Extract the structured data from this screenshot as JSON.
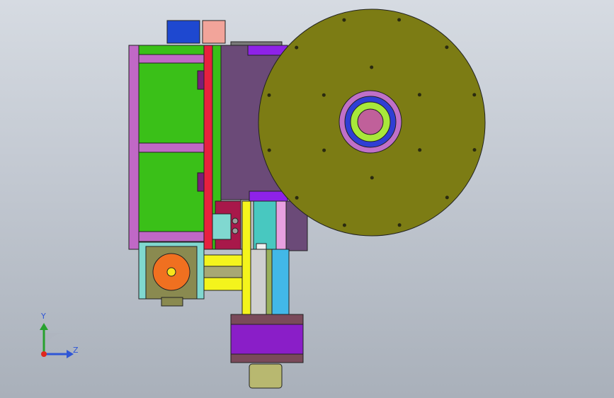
{
  "viewport": {
    "kind": "3D CAD assembly view (orthographic, top view)",
    "background_gradient": [
      "#d6dbe2",
      "#a9b0ba"
    ]
  },
  "triad": {
    "y_label": "Y",
    "z_label": "Z",
    "colors": {
      "y": "#27a12e",
      "z": "#2f56d6",
      "x": "#e0271e"
    }
  },
  "parts": {
    "top_blocks": {
      "blue": "#1e48d0",
      "pink": "#f2a49a"
    },
    "frame_purple": "#c068c6",
    "green_panel": "#3ac018",
    "red_plate": "#e8213e",
    "mauve_housing": "#6b4a78",
    "violet_bracket": "#8e22e8",
    "disc": {
      "fill": "#7c7c14",
      "hub_pink": "#c070c8",
      "hub_blue": "#2f3ed4",
      "hub_green": "#a8e83a",
      "hub_center": "#c0609a"
    },
    "motor": {
      "plate": "#8a8a50",
      "rotor": "#f07020",
      "rotor_center": "#f8e41c",
      "mount": "#80d8d0"
    },
    "yellow_link": "#f4f41c",
    "rail": {
      "cyan": "#48c8c0",
      "blue": "#42b8e8"
    },
    "lower_motor": {
      "body": "#8a1ec8",
      "cap": "#7a4a5a"
    },
    "pulley": "#b8b870",
    "limit_block": "#a8184a"
  }
}
